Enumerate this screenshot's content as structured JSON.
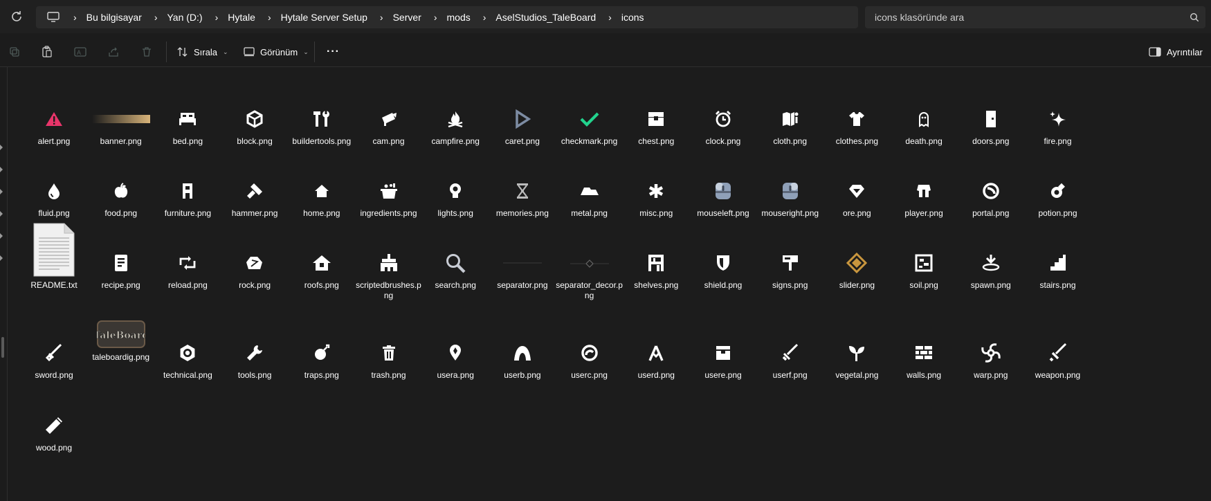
{
  "nav": {
    "refresh_icon": "refresh-icon"
  },
  "breadcrumb": {
    "items": [
      "Bu bilgisayar",
      "Yan (D:)",
      "Hytale",
      "Hytale Server Setup",
      "Server",
      "mods",
      "AselStudios_TaleBoard",
      "icons"
    ]
  },
  "search": {
    "placeholder": "icons klasöründe ara"
  },
  "toolbar": {
    "sort_label": "Sırala",
    "view_label": "Görünüm",
    "more_label": "···",
    "details_label": "Ayrıntılar"
  },
  "files": [
    {
      "name": "alert.png",
      "icon": "alert-icon",
      "color": "#e8356a"
    },
    {
      "name": "banner.png",
      "icon": "banner-icon",
      "color": "#d8b47a"
    },
    {
      "name": "bed.png",
      "icon": "bed-icon",
      "color": "#ffffff"
    },
    {
      "name": "block.png",
      "icon": "block-icon",
      "color": "#ffffff"
    },
    {
      "name": "buildertools.png",
      "icon": "buildertools-icon",
      "color": "#ffffff"
    },
    {
      "name": "cam.png",
      "icon": "cam-icon",
      "color": "#ffffff"
    },
    {
      "name": "campfire.png",
      "icon": "campfire-icon",
      "color": "#ffffff"
    },
    {
      "name": "caret.png",
      "icon": "caret-icon",
      "color": "#7d8ca3"
    },
    {
      "name": "checkmark.png",
      "icon": "checkmark-icon",
      "color": "#22d38d"
    },
    {
      "name": "chest.png",
      "icon": "chest-icon",
      "color": "#ffffff"
    },
    {
      "name": "clock.png",
      "icon": "clock-icon",
      "color": "#ffffff"
    },
    {
      "name": "cloth.png",
      "icon": "cloth-icon",
      "color": "#ffffff"
    },
    {
      "name": "clothes.png",
      "icon": "clothes-icon",
      "color": "#ffffff"
    },
    {
      "name": "death.png",
      "icon": "death-icon",
      "color": "#ffffff"
    },
    {
      "name": "doors.png",
      "icon": "doors-icon",
      "color": "#ffffff"
    },
    {
      "name": "fire.png",
      "icon": "fire-icon",
      "color": "#ffffff"
    },
    {
      "name": "fluid.png",
      "icon": "fluid-icon",
      "color": "#ffffff"
    },
    {
      "name": "food.png",
      "icon": "food-icon",
      "color": "#ffffff"
    },
    {
      "name": "furniture.png",
      "icon": "furniture-icon",
      "color": "#ffffff"
    },
    {
      "name": "hammer.png",
      "icon": "hammer-icon",
      "color": "#ffffff"
    },
    {
      "name": "home.png",
      "icon": "home-icon",
      "color": "#ffffff"
    },
    {
      "name": "ingredients.png",
      "icon": "ingredients-icon",
      "color": "#ffffff"
    },
    {
      "name": "lights.png",
      "icon": "lights-icon",
      "color": "#ffffff"
    },
    {
      "name": "memories.png",
      "icon": "memories-icon",
      "color": "#bbbbbb"
    },
    {
      "name": "metal.png",
      "icon": "metal-icon",
      "color": "#ffffff"
    },
    {
      "name": "misc.png",
      "icon": "misc-icon",
      "color": "#ffffff"
    },
    {
      "name": "mouseleft.png",
      "icon": "mouseleft-icon",
      "color": "#8fa0b8"
    },
    {
      "name": "mouseright.png",
      "icon": "mouseright-icon",
      "color": "#8fa0b8"
    },
    {
      "name": "ore.png",
      "icon": "ore-icon",
      "color": "#ffffff"
    },
    {
      "name": "player.png",
      "icon": "player-icon",
      "color": "#ffffff"
    },
    {
      "name": "portal.png",
      "icon": "portal-icon",
      "color": "#ffffff"
    },
    {
      "name": "potion.png",
      "icon": "potion-icon",
      "color": "#ffffff"
    },
    {
      "name": "README.txt",
      "icon": "text-document-icon",
      "color": "#f0f0f0"
    },
    {
      "name": "recipe.png",
      "icon": "recipe-icon",
      "color": "#ffffff"
    },
    {
      "name": "reload.png",
      "icon": "reload-icon",
      "color": "#ffffff"
    },
    {
      "name": "rock.png",
      "icon": "rock-icon",
      "color": "#ffffff"
    },
    {
      "name": "roofs.png",
      "icon": "roofs-icon",
      "color": "#ffffff"
    },
    {
      "name": "scriptedbrushes.png",
      "icon": "scriptedbrushes-icon",
      "color": "#ffffff"
    },
    {
      "name": "search.png",
      "icon": "magnifier-icon",
      "color": "#c8ccd4"
    },
    {
      "name": "separator.png",
      "icon": "separator-icon",
      "color": "#3a3a3a"
    },
    {
      "name": "separator_decor.png",
      "icon": "separator-decor-icon",
      "color": "#3a3a3a"
    },
    {
      "name": "shelves.png",
      "icon": "shelves-icon",
      "color": "#ffffff"
    },
    {
      "name": "shield.png",
      "icon": "shield-icon",
      "color": "#ffffff"
    },
    {
      "name": "signs.png",
      "icon": "signs-icon",
      "color": "#ffffff"
    },
    {
      "name": "slider.png",
      "icon": "slider-icon",
      "color": "#c9963e"
    },
    {
      "name": "soil.png",
      "icon": "soil-icon",
      "color": "#ffffff"
    },
    {
      "name": "spawn.png",
      "icon": "spawn-icon",
      "color": "#ffffff"
    },
    {
      "name": "stairs.png",
      "icon": "stairs-icon",
      "color": "#ffffff"
    },
    {
      "name": "sword.png",
      "icon": "sword-icon",
      "color": "#ffffff"
    },
    {
      "name": "taleboardig.png",
      "icon": "taleboard-logo-icon",
      "color": "#c9c4b8"
    },
    {
      "name": "technical.png",
      "icon": "technical-icon",
      "color": "#ffffff"
    },
    {
      "name": "tools.png",
      "icon": "tools-icon",
      "color": "#ffffff"
    },
    {
      "name": "traps.png",
      "icon": "traps-icon",
      "color": "#ffffff"
    },
    {
      "name": "trash.png",
      "icon": "trash-icon",
      "color": "#ffffff"
    },
    {
      "name": "usera.png",
      "icon": "usera-icon",
      "color": "#ffffff"
    },
    {
      "name": "userb.png",
      "icon": "userb-icon",
      "color": "#ffffff"
    },
    {
      "name": "userc.png",
      "icon": "userc-icon",
      "color": "#ffffff"
    },
    {
      "name": "userd.png",
      "icon": "userd-icon",
      "color": "#ffffff"
    },
    {
      "name": "usere.png",
      "icon": "usere-icon",
      "color": "#ffffff"
    },
    {
      "name": "userf.png",
      "icon": "userf-icon",
      "color": "#ffffff"
    },
    {
      "name": "vegetal.png",
      "icon": "vegetal-icon",
      "color": "#ffffff"
    },
    {
      "name": "walls.png",
      "icon": "walls-icon",
      "color": "#ffffff"
    },
    {
      "name": "warp.png",
      "icon": "warp-icon",
      "color": "#ffffff"
    },
    {
      "name": "weapon.png",
      "icon": "weapon-icon",
      "color": "#ffffff"
    },
    {
      "name": "wood.png",
      "icon": "wood-icon",
      "color": "#ffffff"
    }
  ]
}
